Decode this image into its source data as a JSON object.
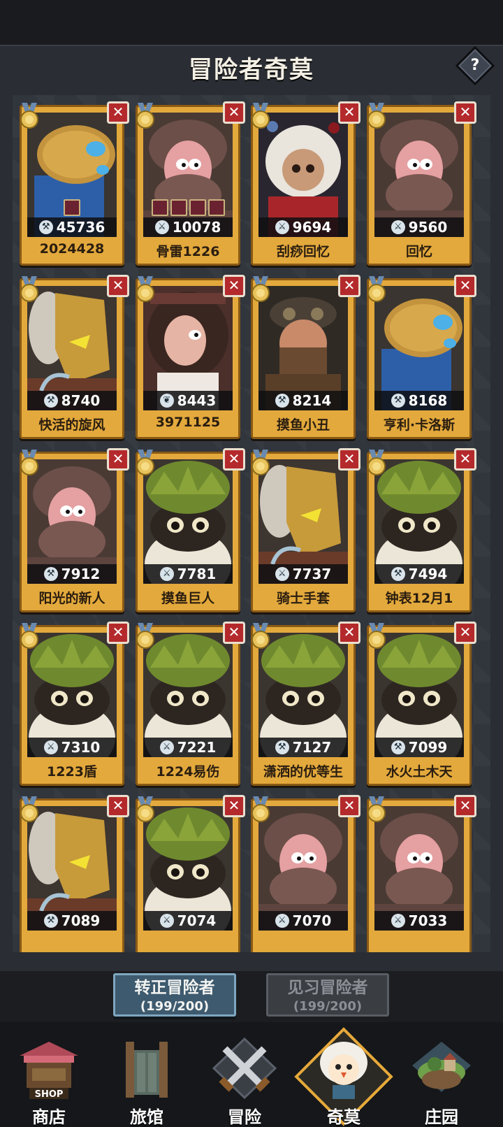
{
  "header": {
    "title": "冒险者奇莫",
    "help_label": "?"
  },
  "colors": {
    "card_gold": "#e3a93c",
    "remove_red": "#b42a2c",
    "tab_active": "#3e5a6e",
    "nav_active_border": "#e6a93a"
  },
  "cards": [
    {
      "name": "2024428",
      "power": "45736",
      "icon": "wrench-icon",
      "portrait": "hooded-robot",
      "items": 1
    },
    {
      "name": "骨雷1226",
      "power": "10078",
      "icon": "sword-icon",
      "portrait": "hippo-hood",
      "items": 4
    },
    {
      "name": "刮痧回忆",
      "power": "9694",
      "icon": "sword-icon",
      "portrait": "white-hair-girl",
      "items": 0
    },
    {
      "name": "回忆",
      "power": "9560",
      "icon": "sword-icon",
      "portrait": "hippo-hood",
      "items": 0
    },
    {
      "name": "快活的旋风",
      "power": "8740",
      "icon": "wrench-icon",
      "portrait": "golden-helm",
      "items": 0
    },
    {
      "name": "3971125",
      "power": "8443",
      "icon": "leaf-icon",
      "portrait": "dark-hair-girl",
      "items": 0
    },
    {
      "name": "摸鱼小丑",
      "power": "8214",
      "icon": "wrench-icon",
      "portrait": "bandit",
      "items": 0
    },
    {
      "name": "亨利·卡洛斯",
      "power": "8168",
      "icon": "wrench-icon",
      "portrait": "hooded-robot",
      "items": 0
    },
    {
      "name": "阳光的新人",
      "power": "7912",
      "icon": "wrench-icon",
      "portrait": "hippo-hood",
      "items": 0
    },
    {
      "name": "摸鱼巨人",
      "power": "7781",
      "icon": "sword-icon",
      "portrait": "raccoon",
      "items": 0
    },
    {
      "name": "骑士手套",
      "power": "7737",
      "icon": "sword-icon",
      "portrait": "golden-helm",
      "items": 0
    },
    {
      "name": "钟表12月1",
      "power": "7494",
      "icon": "wrench-icon",
      "portrait": "raccoon",
      "items": 0
    },
    {
      "name": "1223盾",
      "power": "7310",
      "icon": "sword-icon",
      "portrait": "raccoon",
      "items": 0
    },
    {
      "name": "1224易伤",
      "power": "7221",
      "icon": "sword-icon",
      "portrait": "raccoon",
      "items": 0
    },
    {
      "name": "潇洒的优等生",
      "power": "7127",
      "icon": "wrench-icon",
      "portrait": "raccoon",
      "items": 0
    },
    {
      "name": "水火土木天",
      "power": "7099",
      "icon": "wrench-icon",
      "portrait": "raccoon",
      "items": 0
    },
    {
      "name": "",
      "power": "7089",
      "icon": "wrench-icon",
      "portrait": "golden-helm",
      "items": 0
    },
    {
      "name": "",
      "power": "7074",
      "icon": "sword-icon",
      "portrait": "raccoon",
      "items": 0
    },
    {
      "name": "",
      "power": "7070",
      "icon": "sword-icon",
      "portrait": "hippo-hood",
      "items": 0
    },
    {
      "name": "",
      "power": "7033",
      "icon": "sword-icon",
      "portrait": "hippo-hood",
      "items": 0
    }
  ],
  "tabs": [
    {
      "label": "转正冒险者",
      "count": "(199/200)",
      "active": true
    },
    {
      "label": "见习冒险者",
      "count": "(199/200)",
      "active": false
    }
  ],
  "nav": [
    {
      "label": "商店",
      "icon": "shop-icon",
      "shop_sign": "SHOP"
    },
    {
      "label": "旅馆",
      "icon": "inn-door-icon"
    },
    {
      "label": "冒险",
      "icon": "crossed-swords-icon"
    },
    {
      "label": "奇莫",
      "icon": "chimo-character-icon",
      "active": true
    },
    {
      "label": "庄园",
      "icon": "island-manor-icon"
    }
  ]
}
